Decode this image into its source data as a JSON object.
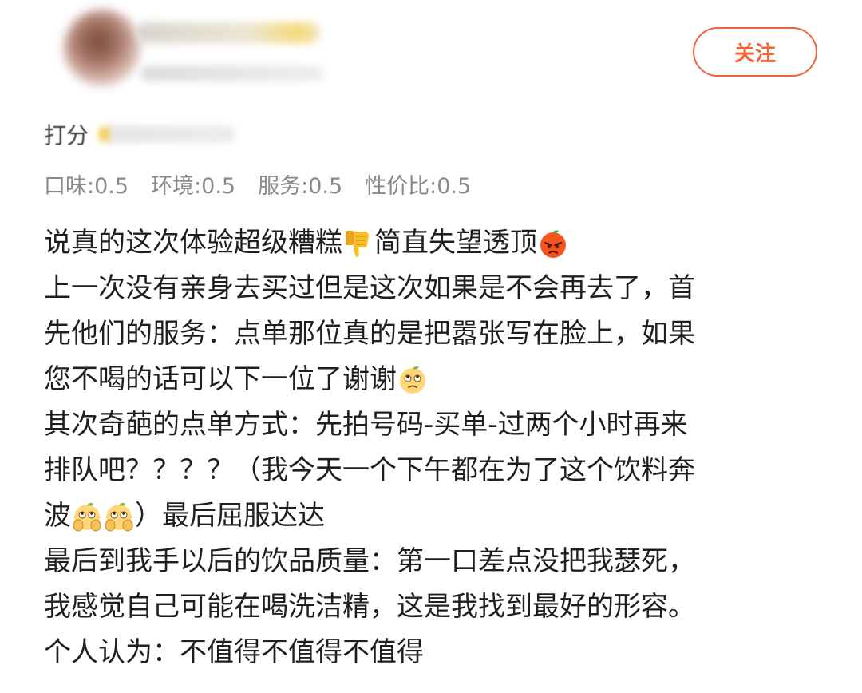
{
  "header": {
    "follow_label": "关注"
  },
  "rating": {
    "label": "打分"
  },
  "scores": [
    "口味:0.5",
    "环境:0.5",
    "服务:0.5",
    "性价比:0.5"
  ],
  "review": {
    "line1": {
      "a": "说真的这次体验超级糟糕",
      "b": "简直失望透顶"
    },
    "line2": "上一次没有亲身去买过但是这次如果是不会再去了，首",
    "line3": "先他们的服务：点单那位真的是把嚣张写在脸上，如果",
    "line4": "您不喝的话可以下一位了谢谢",
    "line5": "其次奇葩的点单方式：先拍号码-买单-过两个小时再来",
    "line6": "排队吧？？？？（我今天一个下午都在为了这个饮料奔",
    "line7": {
      "a": "波",
      "b": "）最后屈服达达"
    },
    "line8": "最后到我手以后的饮品质量：第一口差点没把我瑟死，",
    "line9": "我感觉自己可能在喝洗洁精，这是我找到最好的形容。",
    "line10": "个人认为：不值得不值得不值得"
  },
  "icons": {
    "thumbs_down": "thumbs-down-emoji",
    "angry_orange": "angry-orange-emoji",
    "eyeroll_orange": "eyeroll-orange-emoji",
    "facepalm_orange": "facepalm-orange-emoji"
  },
  "colors": {
    "accent": "#f0643a",
    "score_text": "#8a8a8a",
    "body_text": "#1f1f1f"
  }
}
